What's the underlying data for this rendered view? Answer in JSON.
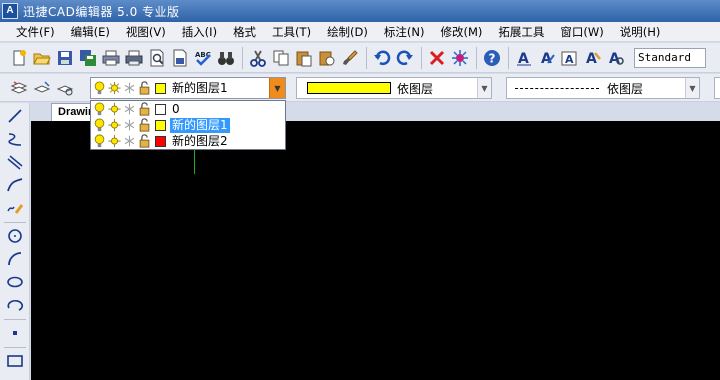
{
  "window": {
    "title": "迅捷CAD编辑器 5.0 专业版",
    "icon_text": "A"
  },
  "menu": [
    {
      "label": "文件(F)",
      "name": "menu-file"
    },
    {
      "label": "编辑(E)",
      "name": "menu-edit"
    },
    {
      "label": "视图(V)",
      "name": "menu-view"
    },
    {
      "label": "插入(I)",
      "name": "menu-insert"
    },
    {
      "label": "格式",
      "name": "menu-format"
    },
    {
      "label": "工具(T)",
      "name": "menu-tools"
    },
    {
      "label": "绘制(D)",
      "name": "menu-draw"
    },
    {
      "label": "标注(N)",
      "name": "menu-dimension"
    },
    {
      "label": "修改(M)",
      "name": "menu-modify"
    },
    {
      "label": "拓展工具",
      "name": "menu-extend-tools"
    },
    {
      "label": "窗口(W)",
      "name": "menu-window"
    },
    {
      "label": "说明(H)",
      "name": "menu-help"
    }
  ],
  "toolbar": {
    "text_style": "Standard",
    "spell_icon_text": "ABC"
  },
  "layer": {
    "current": {
      "name": "新的图层1",
      "color": "#ffff00"
    },
    "list": [
      {
        "name": "0",
        "color": "#ffffff",
        "selected": false
      },
      {
        "name": "新的图层1",
        "color": "#ffff00",
        "selected": true
      },
      {
        "name": "新的图层2",
        "color": "#ff0000",
        "selected": false
      }
    ]
  },
  "color_combo": {
    "label": "依图层",
    "swatch": "#ffff00"
  },
  "linetype_combo": {
    "label": "依图层"
  },
  "drawing": {
    "tab_label": "Drawin",
    "background": "#000000"
  }
}
